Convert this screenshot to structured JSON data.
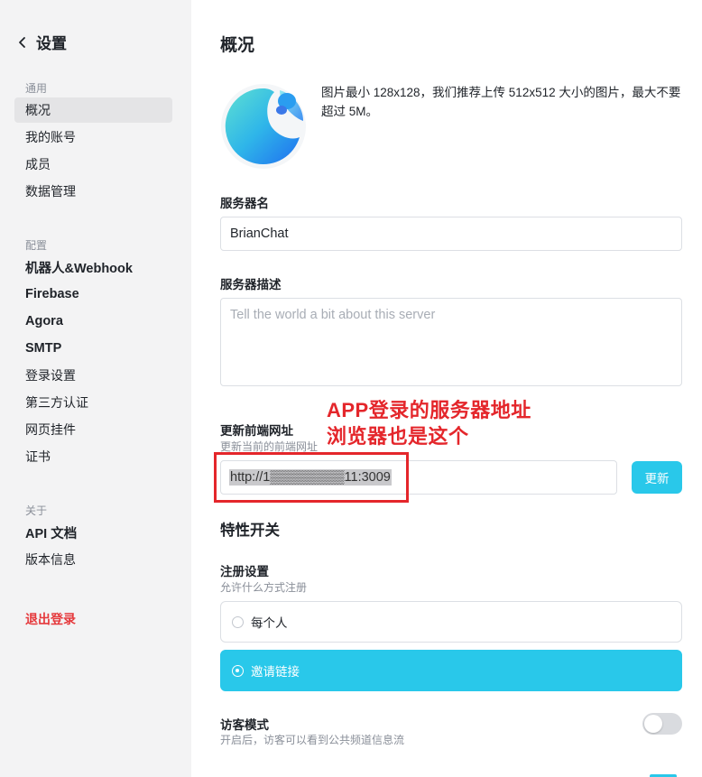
{
  "sidebar": {
    "back_title": "设置",
    "sections": {
      "general": "通用",
      "config": "配置",
      "about": "关于"
    },
    "general_items": [
      "概况",
      "我的账号",
      "成员",
      "数据管理"
    ],
    "config_items": [
      "机器人&Webhook",
      "Firebase",
      "Agora",
      "SMTP",
      "登录设置",
      "第三方认证",
      "网页挂件",
      "证书"
    ],
    "about_items": [
      "API 文档",
      "版本信息"
    ],
    "logout": "退出登录"
  },
  "main": {
    "title": "概况",
    "avatar_hint": "图片最小 128x128，我们推荐上传 512x512 大小的图片，最大不要超过 5M。",
    "server_name_label": "服务器名",
    "server_name_value": "BrianChat",
    "server_desc_label": "服务器描述",
    "server_desc_placeholder": "Tell the world a bit about this server",
    "frontend_url_label": "更新前端网址",
    "frontend_url_sub": "更新当前的前端网址",
    "frontend_url_value": "http://1▒▒▒▒▒▒▒▒11:3009",
    "update_button": "更新",
    "annotation_line1": "APP登录的服务器地址",
    "annotation_line2": "浏览器也是这个",
    "features_title": "特性开关",
    "register_label": "注册设置",
    "register_sub": "允许什么方式注册",
    "register_options": [
      "每个人",
      "邀请链接"
    ],
    "register_selected": "邀请链接",
    "guest_label": "访客模式",
    "guest_sub": "开启后，访客可以看到公共频道信息流",
    "guest_enabled": false
  },
  "colors": {
    "accent": "#29c8ea",
    "annotation": "#e4262b",
    "logout": "#e5383b",
    "sidebar_bg": "#f3f3f4"
  }
}
